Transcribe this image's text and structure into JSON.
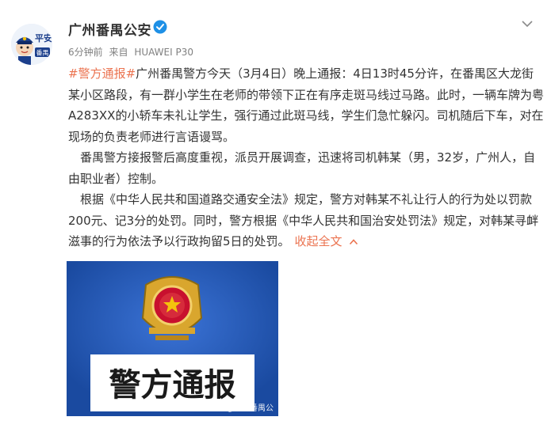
{
  "account": {
    "name": "广州番禺公安",
    "avatar_text_top": "平安",
    "avatar_text_badge": "番禺",
    "verified_icon": "verified-icon"
  },
  "meta": {
    "time": "6分钟前",
    "source_prefix": "来自",
    "source": "HUAWEI P30"
  },
  "post": {
    "hashtag": "#警方通报#",
    "p1_rest": "广州番禺警方今天（3月4日）晚上通报：4日13时45分许，在番禺区大龙街某小区路段，有一群小学生在老师的带领下正在有序走斑马线过马路。此时，一辆车牌为粤A283XX的小轿车未礼让学生，强行通过此斑马线，学生们急忙躲闪。司机随后下车，对在现场的负责老师进行言语谩骂。",
    "p2": "番禺警方接报警后高度重视，派员开展调查，迅速将司机韩某（男，32岁，广州人，自由职业者）控制。",
    "p3": "根据《中华人民共和国道路交通安全法》规定，警方对韩某不礼让行人的行为处以罚款200元、记3分的处罚。同时，警方根据《中华人民共和国治安处罚法》规定，对韩某寻衅滋事的行为依法予以行政拘留5日的处罚。",
    "collapse_label": "收起全文"
  },
  "image": {
    "caption": "警方通报",
    "watermark": "@广州番禺公"
  },
  "colors": {
    "link": "#eb7350",
    "text": "#333333",
    "meta": "#808080",
    "image_bg": "#1f55b5"
  }
}
